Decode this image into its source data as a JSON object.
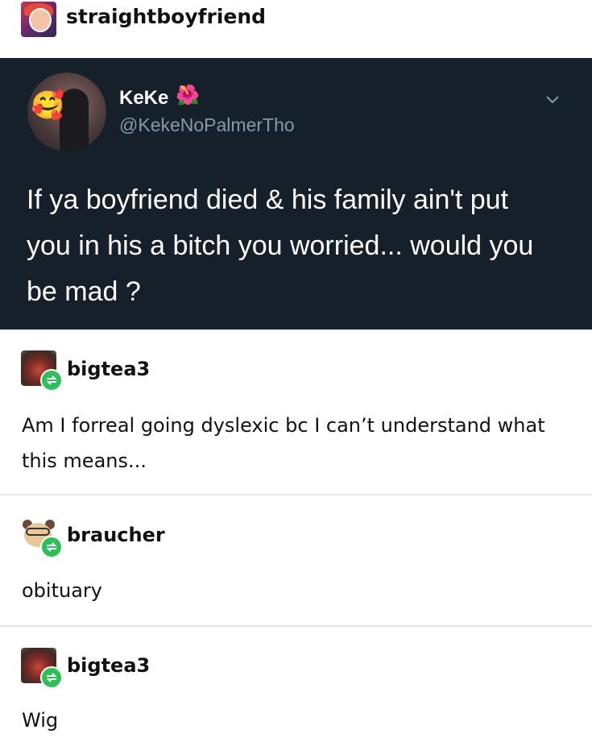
{
  "post": {
    "author": "straightboyfriend"
  },
  "tweet": {
    "display_name": "KeKe",
    "flower_emoji": "🌺",
    "handle": "@KekeNoPalmerTho",
    "avatar_emoji": "🥰",
    "text": "If ya boyfriend died & his family ain't put you in his a bitch you worried... would you be mad ?",
    "caret_icon": "chevron-down-icon",
    "colors": {
      "background": "#15202b",
      "text": "#ffffff",
      "secondary": "#8899a6"
    }
  },
  "replies": [
    {
      "username": "bigtea3",
      "text": "Am I forreal going dyslexic bc I can’t understand what this means..."
    },
    {
      "username": "braucher",
      "text": "obituary"
    },
    {
      "username": "bigtea3",
      "text": "Wig"
    }
  ],
  "icons": {
    "reblog": "reblog-icon",
    "reblog_color": "#2fbf5a"
  }
}
